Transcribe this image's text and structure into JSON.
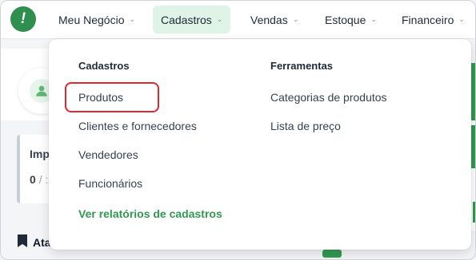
{
  "logo": {
    "glyph": "!"
  },
  "nav": {
    "items": [
      {
        "label": "Meu Negócio"
      },
      {
        "label": "Cadastros"
      },
      {
        "label": "Vendas"
      },
      {
        "label": "Estoque"
      },
      {
        "label": "Financeiro"
      }
    ],
    "chevron": "⌄"
  },
  "background": {
    "stat_label": "Imp",
    "stat_value": "0",
    "stat_sep": "/ :",
    "section_label": "Ata"
  },
  "dropdown": {
    "col1_title": "Cadastros",
    "col1_items": [
      "Produtos",
      "Clientes e fornecedores",
      "Vendedores",
      "Funcionários"
    ],
    "report_link": "Ver relatórios de cadastros",
    "col2_title": "Ferramentas",
    "col2_items": [
      "Categorias de produtos",
      "Lista de preço"
    ]
  },
  "colors": {
    "brand_green": "#2f9a4f",
    "active_tab_bg": "#dff3e6",
    "highlight_red": "#e0282e"
  },
  "icons": {
    "logo": "logo-icon",
    "user": "user-icon",
    "bookmark": "bookmark-icon",
    "chevron": "chevron-down-icon"
  }
}
